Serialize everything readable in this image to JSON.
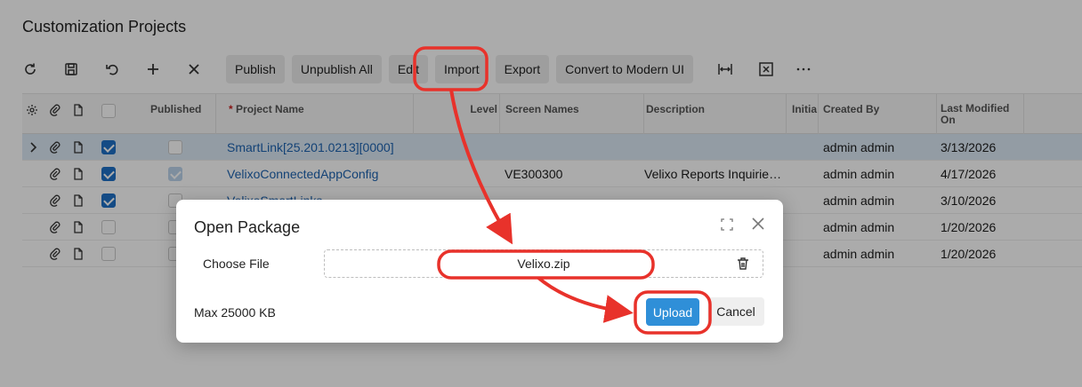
{
  "page": {
    "title": "Customization Projects"
  },
  "toolbar": {
    "icons": [
      "refresh-icon",
      "save-icon",
      "undo-icon",
      "add-icon",
      "delete-icon"
    ],
    "buttons": [
      "Publish",
      "Unpublish All",
      "Edit",
      "Import",
      "Export",
      "Convert to Modern UI"
    ],
    "right_icons": [
      "fit-columns-icon",
      "excel-export-icon",
      "more-icon"
    ]
  },
  "grid": {
    "columns": {
      "published": "Published",
      "project_name": "Project Name",
      "required_mark": "*",
      "level": "Level",
      "screen_names": "Screen Names",
      "description": "Description",
      "initial": "Initia",
      "created_by": "Created By",
      "last_modified": "Last Modified On"
    },
    "rows": [
      {
        "name": "SmartLink[25.201.0213][0000]",
        "screen": "",
        "description": "",
        "created_by": "admin admin",
        "modified": "3/13/2026",
        "selected": true,
        "published": false,
        "expander": true
      },
      {
        "name": "VelixoConnectedAppConfig",
        "screen": "VE300300",
        "description": "Velixo Reports Inquirie…",
        "created_by": "admin admin",
        "modified": "4/17/2026",
        "selected": true,
        "published": true,
        "expander": false
      },
      {
        "name": "VelixoSmartLinks",
        "screen": "",
        "description": "",
        "created_by": "admin admin",
        "modified": "3/10/2026",
        "selected": true,
        "published": false,
        "expander": false
      },
      {
        "name": "",
        "screen": "",
        "description": "",
        "created_by": "admin admin",
        "modified": "1/20/2026",
        "selected": false,
        "published": false,
        "expander": false
      },
      {
        "name": "",
        "screen": "",
        "description": "",
        "created_by": "admin admin",
        "modified": "1/20/2026",
        "selected": false,
        "published": false,
        "expander": false
      }
    ]
  },
  "dialog": {
    "title": "Open Package",
    "choose_file_label": "Choose File",
    "file_name": "Velixo.zip",
    "max_size": "Max 25000 KB",
    "upload_label": "Upload",
    "cancel_label": "Cancel"
  },
  "annotation": {
    "color": "#e8322b"
  }
}
